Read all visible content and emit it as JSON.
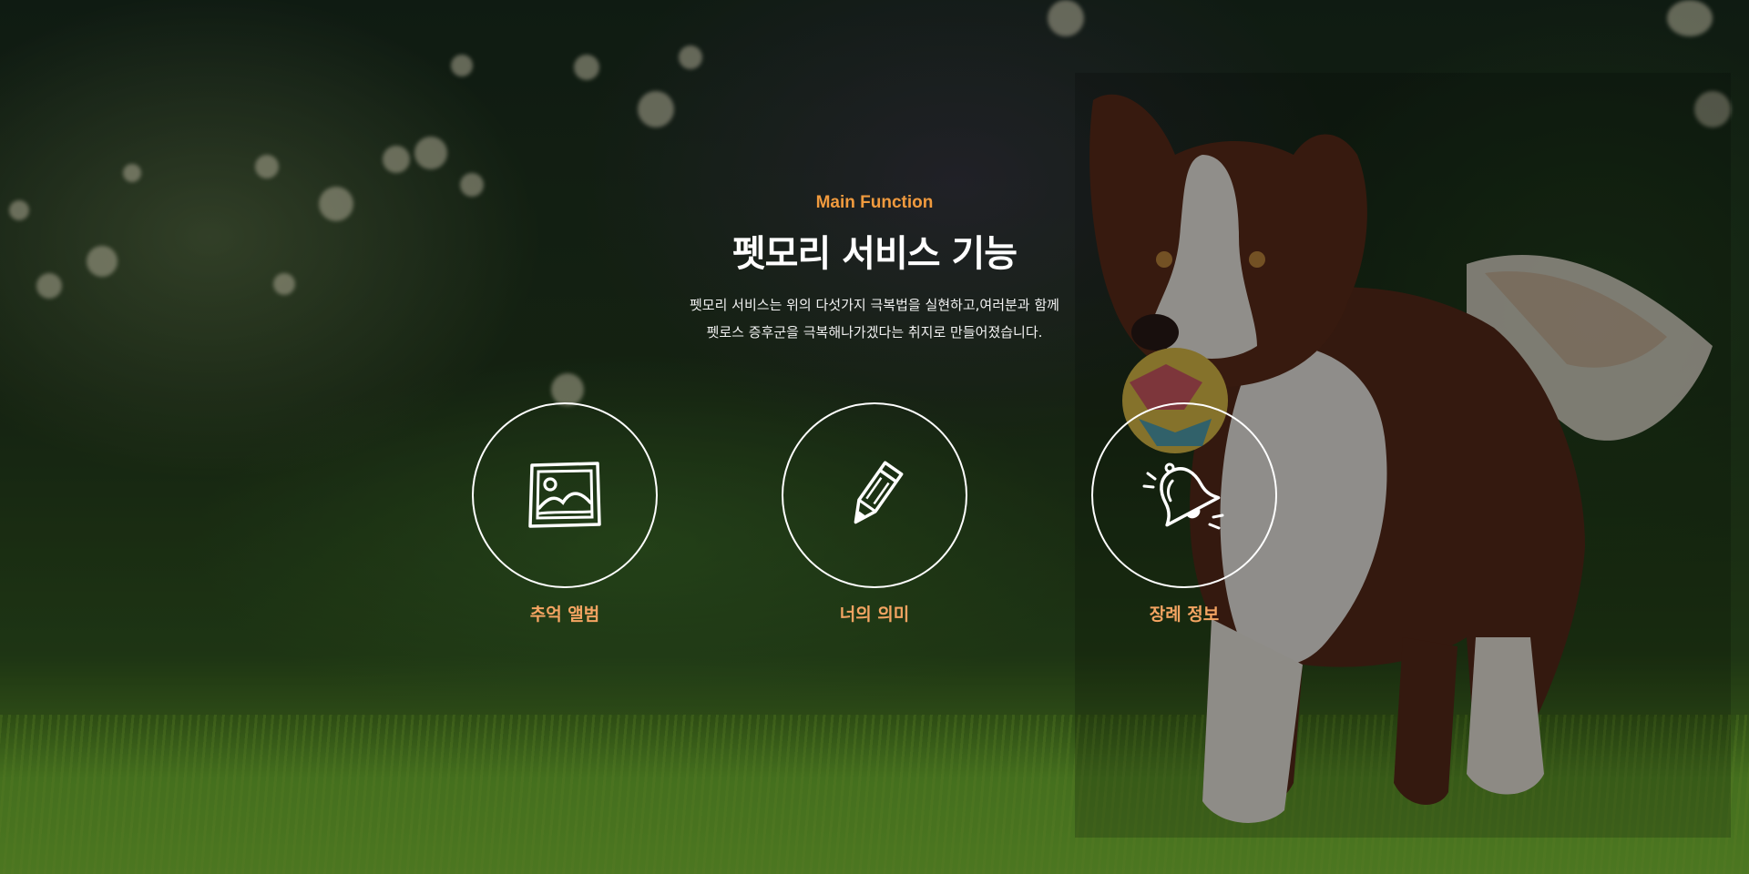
{
  "header": {
    "eyebrow": "Main Function",
    "title": "펫모리 서비스 기능",
    "description_lines": [
      "펫모리 서비스는 위의 다섯가지 극복법을 실현하고,여러분과 함께",
      "펫로스 증후군을 극복해나가겠다는 취지로 만들어졌습니다."
    ]
  },
  "features": [
    {
      "label": "추억 앨범",
      "icon": "photo-album-icon"
    },
    {
      "label": "너의 의미",
      "icon": "pencil-icon"
    },
    {
      "label": "장례 정보",
      "icon": "bell-icon"
    }
  ],
  "colors": {
    "accent": "#f09a3e",
    "feature_label": "#f4a462",
    "title": "#ffffff"
  }
}
